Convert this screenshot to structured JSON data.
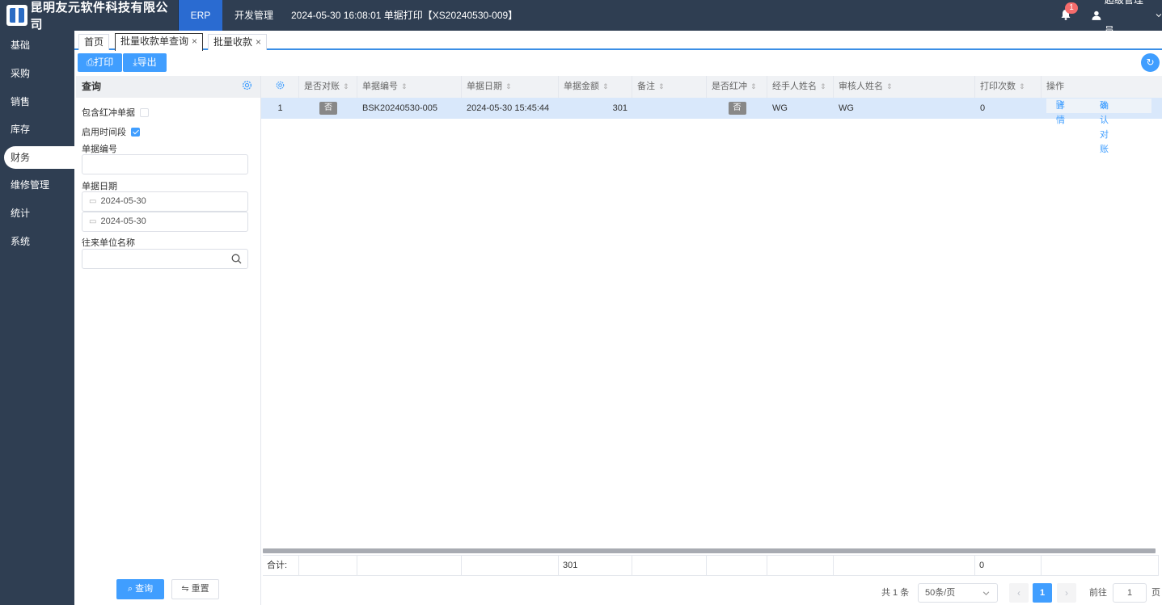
{
  "header": {
    "company": "昆明友元软件科技有限公司",
    "nav": [
      "ERP",
      "开发管理"
    ],
    "status": "2024-05-30 16:08:01 单据打印【XS20240530-009】",
    "notifications": "1",
    "user": "超级管理员"
  },
  "sidebar": {
    "items": [
      "基础",
      "采购",
      "销售",
      "库存",
      "财务",
      "维修管理",
      "统计",
      "系统"
    ],
    "active": "财务"
  },
  "tabs": [
    {
      "label": "首页"
    },
    {
      "label": "批量收款单查询",
      "close": "×"
    },
    {
      "label": "批量收款",
      "close": "×"
    }
  ],
  "toolbar": {
    "print": "打印",
    "export": "导出"
  },
  "query": {
    "title": "查询",
    "include_reversed": "包含红冲单据",
    "enable_period": "启用时间段",
    "doc_no_label": "单据编号",
    "doc_no_value": "",
    "doc_date_label": "单据日期",
    "date_from": "2024-05-30",
    "date_to": "2024-05-30",
    "partner_label": "往来单位名称",
    "partner_value": "",
    "search_btn": "查询",
    "reset_btn": "重置"
  },
  "table": {
    "columns": [
      "是否对账",
      "单据编号",
      "单据日期",
      "单据金额",
      "备注",
      "是否红冲",
      "经手人姓名",
      "审核人姓名",
      "打印次数",
      "操作"
    ],
    "rows": [
      {
        "index": "1",
        "reconciled": "否",
        "doc_no": "BSK20240530-005",
        "doc_date": "2024-05-30 15:45:44",
        "amount": "301",
        "remark": "",
        "reversed": "否",
        "handler": "WG",
        "auditor": "WG",
        "print_count": "0",
        "ops": [
          "详情",
          "确认对账"
        ]
      }
    ],
    "footer": {
      "label": "合计:",
      "amount": "301",
      "print_count": "0"
    }
  },
  "pagination": {
    "total": "共 1 条",
    "page_size": "50条/页",
    "current_page": "1",
    "goto_label": "前往",
    "goto_value": "1",
    "page_suffix": "页"
  },
  "colors": {
    "topbar": "#2f3e52",
    "accent": "#409eff",
    "row_selected": "#d9e8fb"
  }
}
